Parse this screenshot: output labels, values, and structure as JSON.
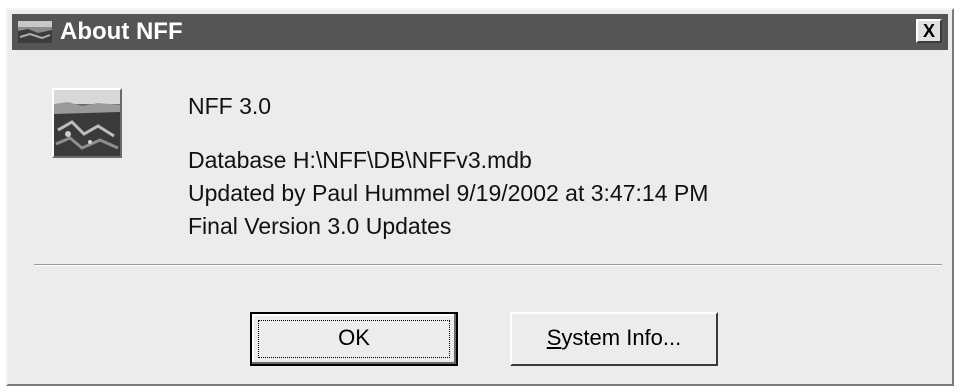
{
  "window": {
    "title": "About NFF",
    "close_label": "X",
    "icon": "nff-app-icon"
  },
  "main": {
    "product": "NFF 3.0",
    "database": "Database H:\\NFF\\DB\\NFFv3.mdb",
    "updated": "Updated by Paul Hummel 9/19/2002 at 3:47:14 PM",
    "notes": "Final Version 3.0 Updates"
  },
  "buttons": {
    "ok_label": "OK",
    "sysinfo_mnemonic": "S",
    "sysinfo_rest": "ystem Info..."
  },
  "colors": {
    "titlebar": "#555555",
    "dialog_bg": "#ececec"
  }
}
